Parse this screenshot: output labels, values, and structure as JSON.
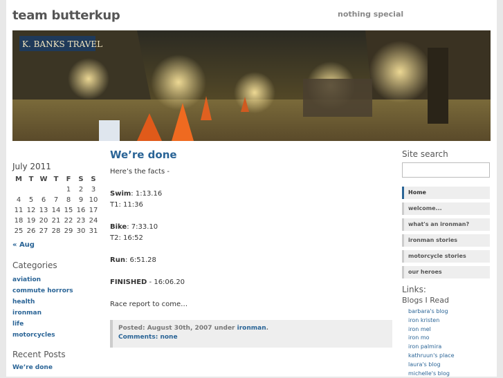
{
  "header": {
    "site_title": "team butterkup",
    "tagline": "nothing special"
  },
  "banner": {
    "sign_text": "K. BANKS TRAVEL"
  },
  "calendar": {
    "title": "July 2011",
    "weekdays": [
      "M",
      "T",
      "W",
      "T",
      "F",
      "S",
      "S"
    ],
    "weeks": [
      [
        "",
        "",
        "",
        "",
        "1",
        "2",
        "3"
      ],
      [
        "4",
        "5",
        "6",
        "7",
        "8",
        "9",
        "10"
      ],
      [
        "11",
        "12",
        "13",
        "14",
        "15",
        "16",
        "17"
      ],
      [
        "18",
        "19",
        "20",
        "21",
        "22",
        "23",
        "24"
      ],
      [
        "25",
        "26",
        "27",
        "28",
        "29",
        "30",
        "31"
      ]
    ],
    "prev_link": "« Aug"
  },
  "categories": {
    "heading": "Categories",
    "items": [
      "aviation",
      "commute horrors",
      "health",
      "ironman",
      "life",
      "motorcycles"
    ]
  },
  "recent_posts": {
    "heading": "Recent Posts",
    "items": [
      "We’re done"
    ]
  },
  "post": {
    "title": "We’re done",
    "intro": "Here’s the facts -",
    "swim_label": "Swim",
    "swim_value": ": 1:13.16",
    "t1": "T1: 11:36",
    "bike_label": "Bike",
    "bike_value": ": 7:33.10",
    "t2": "T2: 16:52",
    "run_label": "Run",
    "run_value": ": 6:51.28",
    "finished_label": "FINISHED",
    "finished_value": " - 16:06.20",
    "closing": "Race report to come…",
    "meta_posted": "Posted: August 30th, 2007 under ",
    "meta_category": "ironman",
    "meta_dot": ".",
    "meta_comments": "Comments: none"
  },
  "sidebar": {
    "search_heading": "Site search",
    "pages": [
      "Home",
      "welcome...",
      "what's an ironman?",
      "ironman stories",
      "motorcycle stories",
      "our heroes"
    ],
    "links_heading": "Links:",
    "blogs_heading": "Blogs I Read",
    "blogs": [
      "barbara's blog",
      "iron kristen",
      "iron mel",
      "iron mo",
      "iron palmira",
      "kathruun's place",
      "laura's blog",
      "michelle's blog"
    ]
  },
  "colors": {
    "link": "#2a6496",
    "background": "#e8e8e8"
  }
}
